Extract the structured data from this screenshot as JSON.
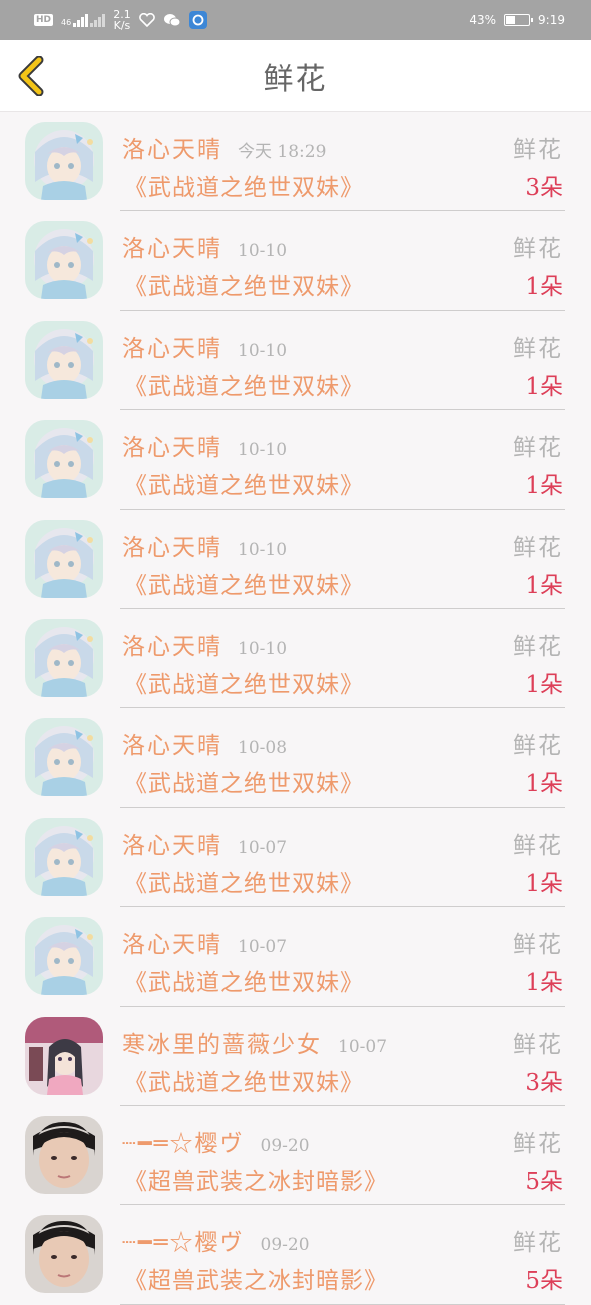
{
  "status_bar": {
    "hd": "HD",
    "network": "46",
    "speed_value": "2.1",
    "speed_unit": "K/s",
    "battery_text": "43%",
    "battery_level": 0.43,
    "time": "9:19"
  },
  "header": {
    "title": "鲜花"
  },
  "colors": {
    "accent": "#ee9a6c",
    "count": "#dd3f58",
    "muted": "#b4b4b4",
    "back": "#f3c417"
  },
  "records": [
    {
      "user": "洛心天晴",
      "time": "今天 18:29",
      "type": "鲜花",
      "book": "《武战道之绝世双妹》",
      "count": "3朵",
      "avatar": "anime-girl"
    },
    {
      "user": "洛心天晴",
      "time": "10-10",
      "type": "鲜花",
      "book": "《武战道之绝世双妹》",
      "count": "1朵",
      "avatar": "anime-girl"
    },
    {
      "user": "洛心天晴",
      "time": "10-10",
      "type": "鲜花",
      "book": "《武战道之绝世双妹》",
      "count": "1朵",
      "avatar": "anime-girl"
    },
    {
      "user": "洛心天晴",
      "time": "10-10",
      "type": "鲜花",
      "book": "《武战道之绝世双妹》",
      "count": "1朵",
      "avatar": "anime-girl"
    },
    {
      "user": "洛心天晴",
      "time": "10-10",
      "type": "鲜花",
      "book": "《武战道之绝世双妹》",
      "count": "1朵",
      "avatar": "anime-girl"
    },
    {
      "user": "洛心天晴",
      "time": "10-10",
      "type": "鲜花",
      "book": "《武战道之绝世双妹》",
      "count": "1朵",
      "avatar": "anime-girl"
    },
    {
      "user": "洛心天晴",
      "time": "10-08",
      "type": "鲜花",
      "book": "《武战道之绝世双妹》",
      "count": "1朵",
      "avatar": "anime-girl"
    },
    {
      "user": "洛心天晴",
      "time": "10-07",
      "type": "鲜花",
      "book": "《武战道之绝世双妹》",
      "count": "1朵",
      "avatar": "anime-girl"
    },
    {
      "user": "洛心天晴",
      "time": "10-07",
      "type": "鲜花",
      "book": "《武战道之绝世双妹》",
      "count": "1朵",
      "avatar": "anime-girl"
    },
    {
      "user": "寒冰里的蔷薇少女",
      "time": "10-07",
      "type": "鲜花",
      "book": "《武战道之绝世双妹》",
      "count": "3朵",
      "avatar": "kimono-girl"
    },
    {
      "user": "┈━═☆樱ヴ",
      "time": "09-20",
      "type": "鲜花",
      "book": "《超兽武装之冰封暗影》",
      "count": "5朵",
      "avatar": "photo-person"
    },
    {
      "user": "┈━═☆樱ヴ",
      "time": "09-20",
      "type": "鲜花",
      "book": "《超兽武装之冰封暗影》",
      "count": "5朵",
      "avatar": "photo-person"
    }
  ]
}
